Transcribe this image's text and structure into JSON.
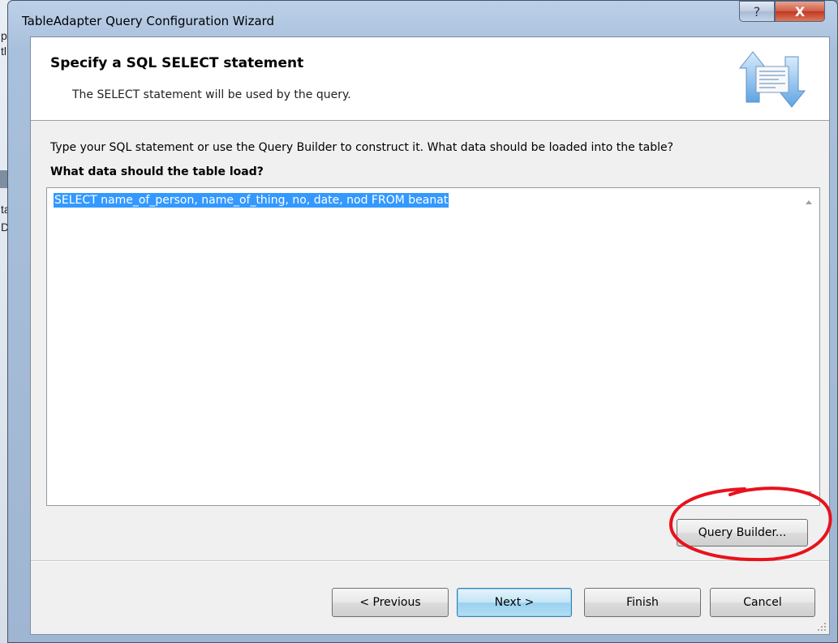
{
  "window": {
    "title": "TableAdapter Query Configuration Wizard",
    "help_glyph": "?",
    "close_glyph": "X"
  },
  "background_app": {
    "fragments": [
      "p",
      "tl",
      "ta",
      "D"
    ]
  },
  "header": {
    "title": "Specify a SQL SELECT statement",
    "subtitle": "The SELECT statement will be used by the query."
  },
  "body": {
    "instruction": "Type your SQL statement or use the Query Builder to construct it. What data should be loaded into the table?",
    "prompt_label": "What data should the table load?",
    "sql_text": "SELECT name_of_person, name_of_thing, no, date, nod FROM beanat"
  },
  "buttons": {
    "query_builder": "Query Builder...",
    "previous": "< Previous",
    "next": "Next >",
    "finish": "Finish",
    "cancel": "Cancel"
  },
  "colors": {
    "selection": "#3399ff",
    "annotation_circle": "#e8121c"
  },
  "icons": {
    "wizard": "database-sync-icon",
    "help": "help-icon",
    "close": "close-icon"
  }
}
